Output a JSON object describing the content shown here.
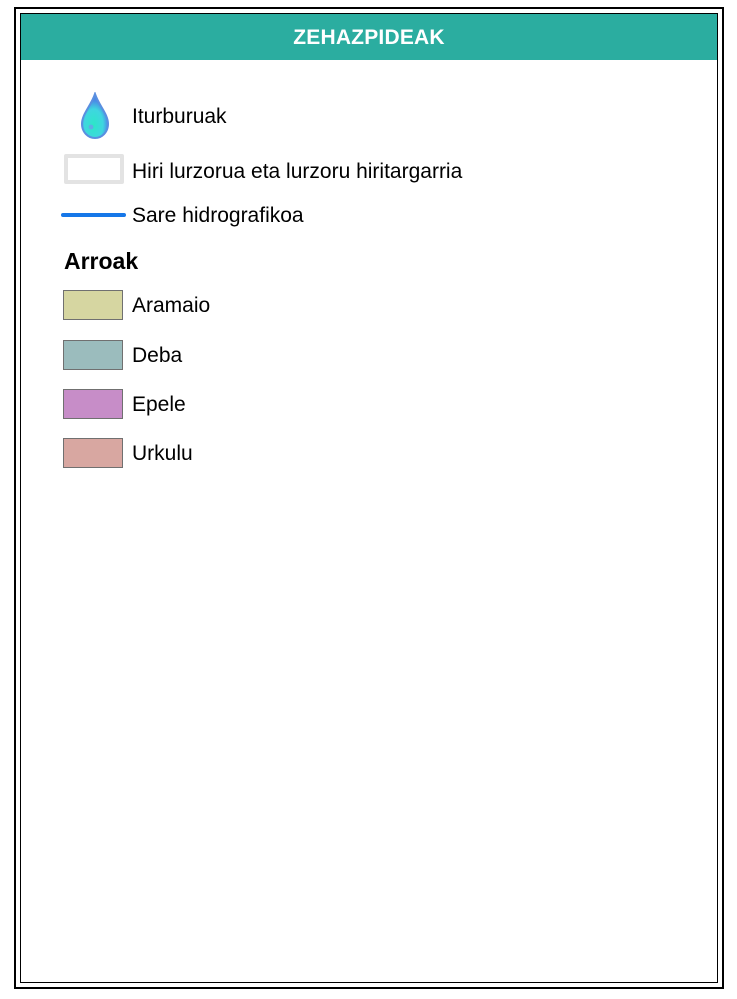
{
  "legend": {
    "title": "ZEHAZPIDEAK",
    "header_color": "#2bada0",
    "items": [
      {
        "icon": "water-drop-icon",
        "label": "Iturburuak",
        "color": "#2de6c8"
      },
      {
        "icon": "urban-area-swatch",
        "label": "Hiri lurzorua eta lurzoru hiritargarria",
        "color": "#e3e3e3"
      },
      {
        "icon": "hydro-line-icon",
        "label": "Sare hidrografikoa",
        "color": "#1677e8"
      }
    ],
    "basins_title": "Arroak",
    "basins": [
      {
        "label": "Aramaio",
        "color": "#d6d6a1"
      },
      {
        "label": "Deba",
        "color": "#9bbcbd"
      },
      {
        "label": "Epele",
        "color": "#c78dc8"
      },
      {
        "label": "Urkulu",
        "color": "#d8a7a1"
      }
    ]
  }
}
